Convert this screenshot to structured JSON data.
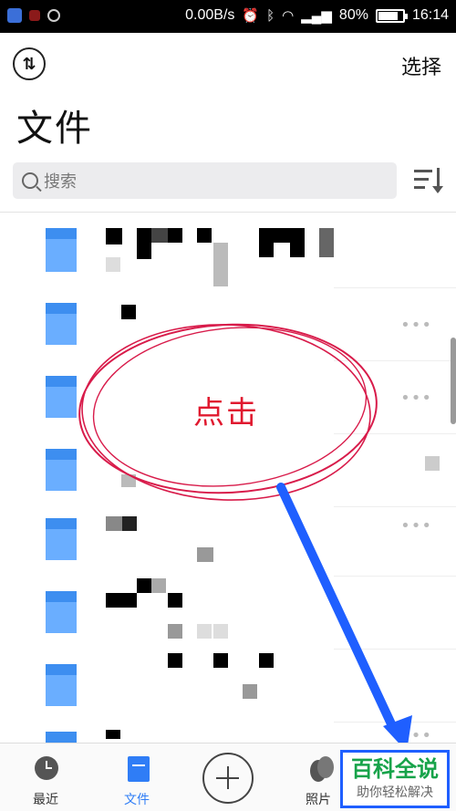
{
  "status_bar": {
    "speed": "0.00B/s",
    "battery": "80%",
    "time": "16:14",
    "icons": [
      "shield-icon",
      "home-icon",
      "record-icon",
      "alarm-icon",
      "bluetooth-icon",
      "wifi-icon",
      "signal-icon"
    ]
  },
  "header": {
    "select_label": "选择",
    "title": "文件"
  },
  "search": {
    "placeholder": "搜索"
  },
  "annotation": {
    "text": "点击",
    "color": "#e0192f",
    "arrow_color": "#1f5fff"
  },
  "tabs": [
    {
      "label": "最近",
      "icon": "clock-icon",
      "active": false
    },
    {
      "label": "文件",
      "icon": "file-icon",
      "active": true
    },
    {
      "label": "",
      "icon": "add-icon",
      "active": false
    },
    {
      "label": "照片",
      "icon": "photo-icon",
      "active": false
    }
  ],
  "watermark": {
    "title": "百科全说",
    "subtitle": "助你轻松解决"
  },
  "colors": {
    "accent": "#2f7df6",
    "folder": "#6aaeff",
    "folder_tab": "#3d8ef0",
    "watermark_green": "#17a34a"
  }
}
